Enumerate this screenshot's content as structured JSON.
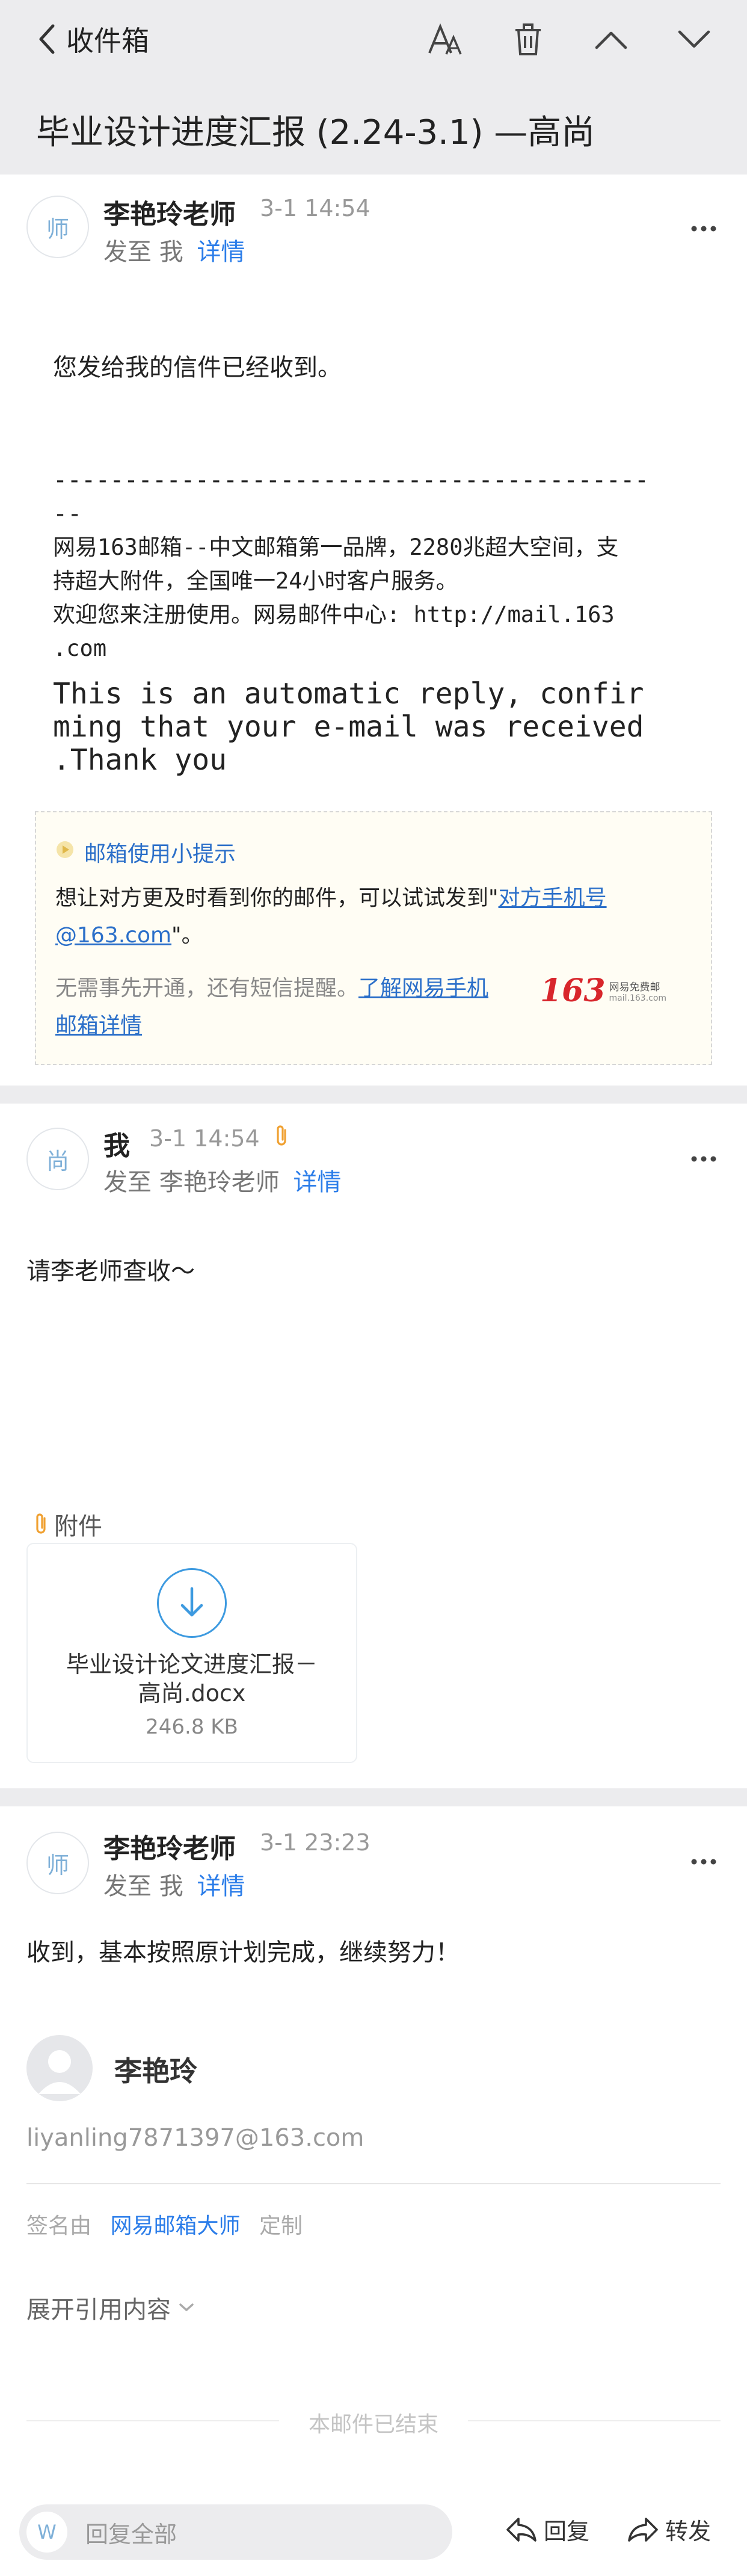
{
  "nav": {
    "back_label": "收件箱",
    "title": "毕业设计进度汇报 (2.24-3.1) —高尚"
  },
  "emails": [
    {
      "avatar_char": "师",
      "sender": "李艳玲老师",
      "time": "3-1 14:54",
      "to_prefix": "发至 我",
      "details_label": "详情",
      "body_line1": "您发给我的信件已经收到。",
      "dash_line1": "------------------------------------------",
      "dash_line2": "--",
      "footer_lines": [
        "网易163邮箱--中文邮箱第一品牌，2280兆超大空间，支",
        "持超大附件，全国唯一24小时客户服务。",
        "欢迎您来注册使用。网易邮件中心: http://mail.163",
        ".com"
      ],
      "auto_reply_lines": [
        "This is an automatic reply, confir",
        "ming that your e-mail was received",
        ".Thank you"
      ],
      "tip": {
        "title": "邮箱使用小提示",
        "line1_text": "想让对方更及时看到你的邮件，可以试试发到\"",
        "line1_link": "对方手机号",
        "line2_link": "@163.com",
        "line2_text": "\"。",
        "sub_text": "无需事先开通，还有短信提醒。",
        "sub_link1": "了解网易手机",
        "sub_link2": "邮箱详情",
        "logo_num": "163",
        "logo_cn": "网易免费邮",
        "logo_url": "mail.163.com"
      }
    },
    {
      "avatar_char": "尚",
      "sender": "我",
      "time": "3-1 14:54",
      "to_prefix": "发至 李艳玲老师",
      "details_label": "详情",
      "body": "请李老师查收～",
      "attachment_header": "附件",
      "attachment_name_line1": "毕业设计论文进度汇报－",
      "attachment_name_line2": "高尚.docx",
      "attachment_size": "246.8 KB"
    },
    {
      "avatar_char": "师",
      "sender": "李艳玲老师",
      "time": "3-1 23:23",
      "to_prefix": "发至 我",
      "details_label": "详情",
      "body": "收到，基本按照原计划完成，继续努力！",
      "sig_name": "李艳玲",
      "sig_email": "liyanling7871397@163.com",
      "sig_prefix": "签名由",
      "sig_brand": "网易邮箱大师",
      "sig_custom": "定制",
      "expand_quote": "展开引用内容",
      "end_label": "本邮件已结束"
    }
  ],
  "bottom": {
    "avatar_char": "W",
    "reply_all_placeholder": "回复全部",
    "reply_label": "回复",
    "forward_label": "转发"
  },
  "colors": {
    "accent": "#2b7de9",
    "background_gray": "#ececee",
    "attachment_orange": "#f0a030",
    "brand_red": "#d8262c"
  }
}
